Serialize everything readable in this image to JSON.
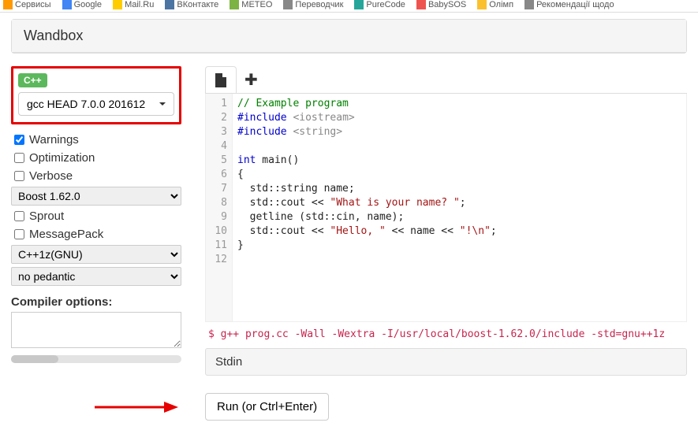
{
  "bookmarks": [
    "Сервисы",
    "Google",
    "Mail.Ru",
    "ВКонтакте",
    "METEO",
    "Переводчик",
    "PureCode",
    "BabySOS",
    "Олімп",
    "Рекомендації щодо"
  ],
  "header": {
    "title": "Wandbox"
  },
  "sidebar": {
    "language_badge": "C++",
    "compiler_label": "gcc HEAD 7.0.0 201612",
    "checks": {
      "warnings": {
        "label": "Warnings",
        "checked": true
      },
      "optimization": {
        "label": "Optimization",
        "checked": false
      },
      "verbose": {
        "label": "Verbose",
        "checked": false
      },
      "sprout": {
        "label": "Sprout",
        "checked": false
      },
      "messagepack": {
        "label": "MessagePack",
        "checked": false
      }
    },
    "select_boost": "Boost 1.62.0",
    "select_std": "C++1z(GNU)",
    "select_pedantic": "no pedantic",
    "compiler_options_label": "Compiler options:"
  },
  "editor": {
    "lines": [
      "1",
      "2",
      "3",
      "4",
      "5",
      "6",
      "7",
      "8",
      "9",
      "10",
      "11",
      "12"
    ],
    "code": {
      "l1": "// Example program",
      "l2a": "#include ",
      "l2b": "<iostream>",
      "l3a": "#include ",
      "l3b": "<string>",
      "l5a": "int",
      "l5b": " main()",
      "l6": "{",
      "l7": "  std::string name;",
      "l8a": "  std::cout << ",
      "l8b": "\"What is your name? \"",
      "l8c": ";",
      "l9": "  getline (std::cin, name);",
      "l10a": "  std::cout << ",
      "l10b": "\"Hello, \"",
      "l10c": " << name << ",
      "l10d": "\"!\\n\"",
      "l10e": ";",
      "l11": "}"
    }
  },
  "command": "$ g++ prog.cc -Wall -Wextra -I/usr/local/boost-1.62.0/include -std=gnu++1z",
  "stdin_label": "Stdin",
  "run_label": "Run (or Ctrl+Enter)"
}
